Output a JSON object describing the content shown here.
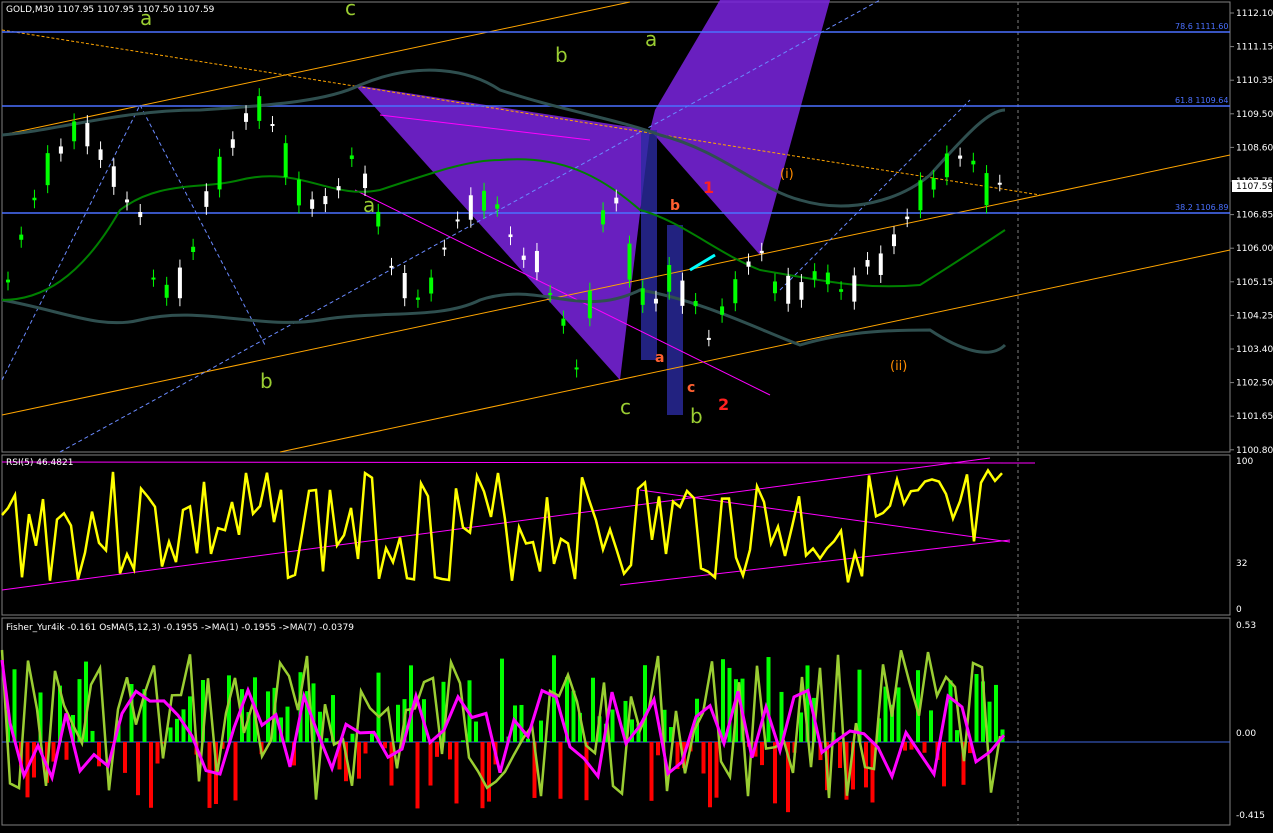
{
  "main": {
    "header": "GOLD,M30  1107.95 1107.95 1107.50 1107.59",
    "price_ticks": [
      "1112.10",
      "1111.15",
      "1110.35",
      "1109.50",
      "1108.60",
      "1107.75",
      "1106.85",
      "1106.00",
      "1105.15",
      "1104.25",
      "1103.40",
      "1102.50",
      "1101.65",
      "1100.80"
    ],
    "current_price": "1107.59",
    "fib_levels": [
      {
        "label": "78.6 1111.60",
        "color": "#4a70ff"
      },
      {
        "label": "61.8 1109.64",
        "color": "#4a70ff"
      },
      {
        "label": "38.2 1106.89",
        "color": "#4a70ff"
      }
    ],
    "wave_labels": {
      "green": [
        "a",
        "c",
        "b",
        "a",
        "a",
        "b",
        "c",
        "b"
      ],
      "red": [
        "1",
        "2",
        "b",
        "a",
        "c"
      ],
      "orange": [
        "(i)",
        "(ii)"
      ]
    },
    "colors": {
      "up_candle": "#ffffff",
      "down_candle": "#00ff00",
      "bollinger": "#2f4f4f",
      "ma": "#008000",
      "channel": "#ffa500",
      "fib": "#4169e1",
      "triangle": "#7b24e0",
      "grid": "#808080",
      "tick_text": "#ffffff"
    }
  },
  "rsi": {
    "header": "RSI(5) 46.4821",
    "ticks": [
      "100",
      "32",
      "0"
    ],
    "colors": {
      "line": "#ffff00",
      "trend": "#ff00ff"
    }
  },
  "fisher": {
    "header": "Fisher_Yur4ik -0.161  OsMA(5,12,3) -0.1955  ->MA(1) -0.1955  ->MA(7) -0.0379",
    "ticks": [
      "0.53",
      "0.00",
      "-0.415"
    ],
    "colors": {
      "pos": "#00ff00",
      "neg": "#ff0000",
      "ma1": "#9acd32",
      "ma7": "#ff00ff",
      "zero": "#4169e1"
    }
  }
}
